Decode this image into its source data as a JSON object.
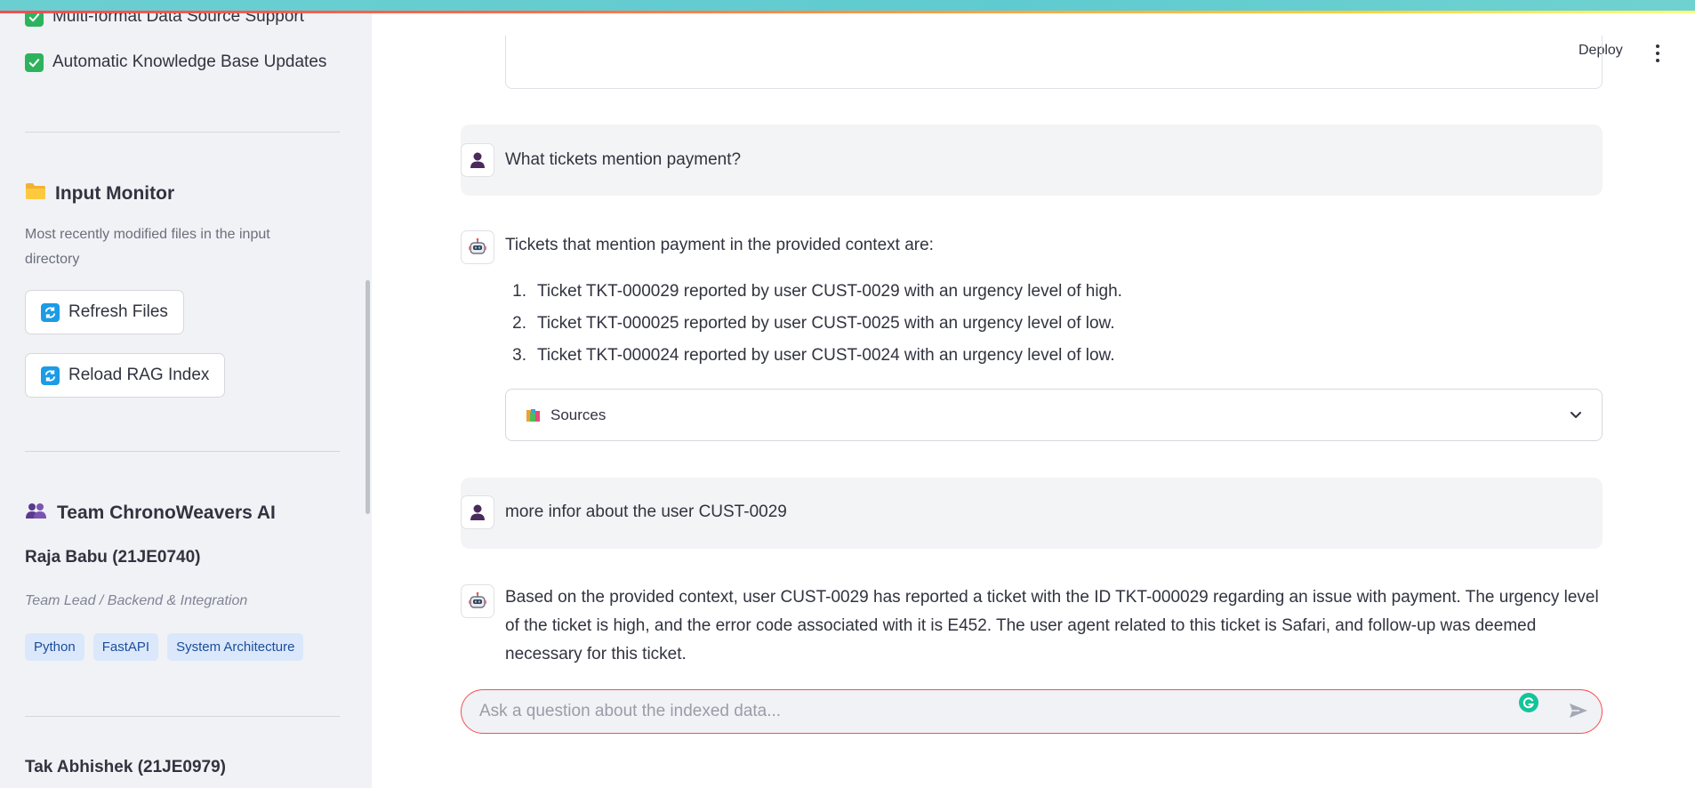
{
  "sidebar": {
    "features": [
      {
        "label": "Multi-format Data Source Support",
        "checked": true
      },
      {
        "label": "Automatic Knowledge Base Updates",
        "checked": true
      }
    ],
    "input_monitor": {
      "icon": "folder-icon",
      "title": "Input Monitor",
      "caption": "Most recently modified files in the input directory",
      "refresh_button": "Refresh Files",
      "reload_button": "Reload RAG Index"
    },
    "team": {
      "icon": "people-icon",
      "title": "Team ChronoWeavers AI",
      "members": [
        {
          "name": "Raja Babu (21JE0740)",
          "role": "Team Lead / Backend & Integration",
          "tags": [
            "Python",
            "FastAPI",
            "System Architecture"
          ]
        },
        {
          "name": "Tak Abhishek (21JE0979)"
        }
      ]
    }
  },
  "header": {
    "deploy_label": "Deploy"
  },
  "chat": {
    "messages": [
      {
        "role": "user",
        "text": "What tickets mention payment?"
      },
      {
        "role": "assistant",
        "text": "Tickets that mention payment in the provided context are:",
        "list": [
          {
            "num": "1.",
            "text": "Ticket TKT-000029 reported by user CUST-0029 with an urgency level of high."
          },
          {
            "num": "2.",
            "text": "Ticket TKT-000025 reported by user CUST-0025 with an urgency level of low."
          },
          {
            "num": "3.",
            "text": "Ticket TKT-000024 reported by user CUST-0024 with an urgency level of low."
          }
        ],
        "sources_label": "Sources"
      },
      {
        "role": "user",
        "text": "more infor about the user CUST-0029"
      },
      {
        "role": "assistant",
        "text": "Based on the provided context, user CUST-0029 has reported a ticket with the ID TKT-000029 regarding an issue with payment. The urgency level of the ticket is high, and the error code associated with it is E452. The user agent related to this ticket is Safari, and follow-up was deemed necessary for this ticket."
      }
    ],
    "input": {
      "placeholder": "Ask a question about the indexed data...",
      "value": ""
    }
  },
  "colors": {
    "accent": "#ff4b4b",
    "check": "#2db35d",
    "refresh": "#1c9be6",
    "tag_bg": "#dbe8fb",
    "sidebar_bg": "#f0f2f6"
  }
}
